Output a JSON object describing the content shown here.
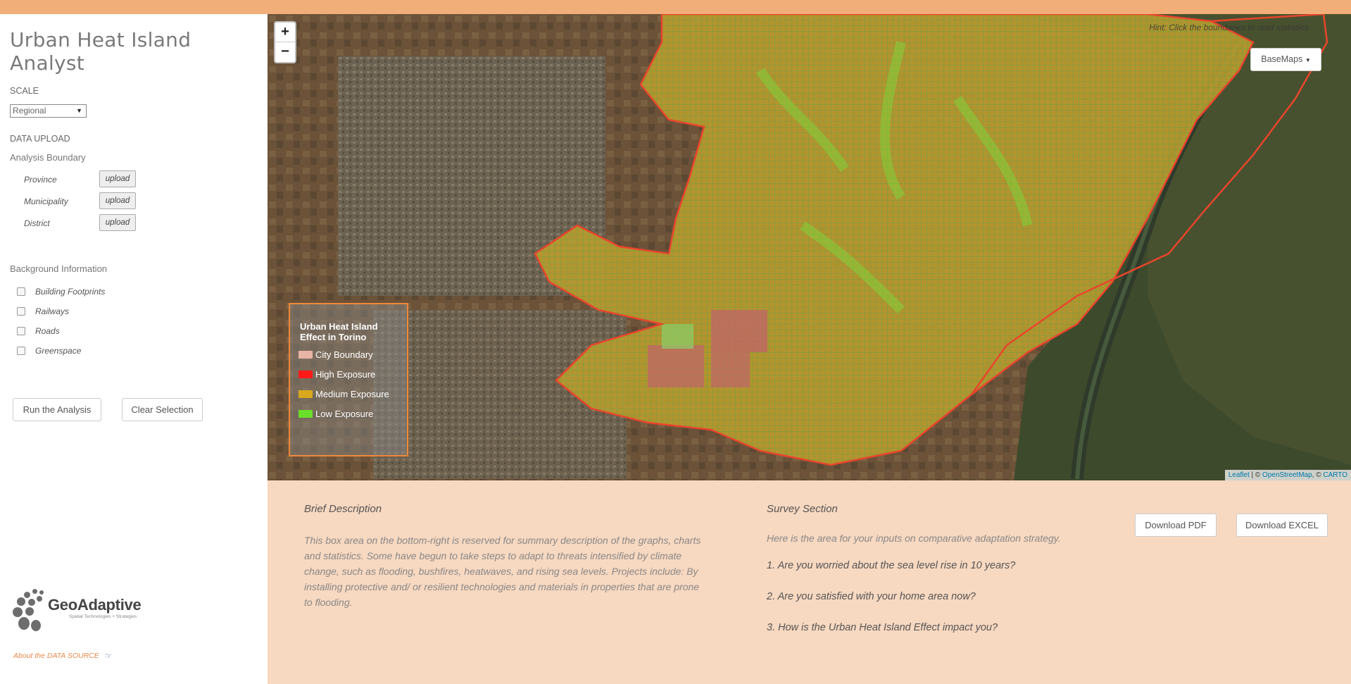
{
  "app": {
    "title": "Urban Heat Island Analyst"
  },
  "sidebar": {
    "scale_label": "SCALE",
    "scale_value": "Regional",
    "data_upload_label": "DATA UPLOAD",
    "analysis_boundary_label": "Analysis Boundary",
    "boundary_rows": [
      {
        "label": "Province",
        "button": "upload"
      },
      {
        "label": "Municipality",
        "button": "upload"
      },
      {
        "label": "District",
        "button": "upload"
      }
    ],
    "background_label": "Background Information",
    "layers": [
      {
        "label": "Building Footprints",
        "checked": false
      },
      {
        "label": "Railways",
        "checked": false
      },
      {
        "label": "Roads",
        "checked": false
      },
      {
        "label": "Greenspace",
        "checked": false
      }
    ],
    "run_button": "Run the Analysis",
    "clear_button": "Clear Selection",
    "logo_name": "GeoAdaptive",
    "logo_tagline": "Spatial Technologies + Strategies",
    "about_link": "About the DATA SOURCE"
  },
  "map": {
    "zoom_in": "+",
    "zoom_out": "−",
    "hint": "Hint: Click the boundaries to read statistics",
    "basemaps_label": "BaseMaps",
    "legend": {
      "title": "Urban Heat Island Effect in Torino",
      "items": [
        {
          "label": "City Boundary",
          "color": "#e8b4a6"
        },
        {
          "label": "High Exposure",
          "color": "#ff1a1a"
        },
        {
          "label": "Medium Exposure",
          "color": "#d9a81e"
        },
        {
          "label": "Low Exposure",
          "color": "#6ae02a"
        }
      ]
    },
    "attribution": {
      "leaflet": "Leaflet",
      "sep1": " | © ",
      "osm": "OpenStreetMap",
      "sep2": ", © ",
      "carto": "CARTO"
    }
  },
  "bottom": {
    "description_title": "Brief Description",
    "description_text": "This box area on the bottom-right is reserved for summary description of the graphs, charts and statistics. Some have begun to take steps to adapt to threats intensified by climate change, such as flooding, bushfires, heatwaves, and rising sea levels. Projects include: By installing protective and/ or resilient technologies and materials in properties that are prone to flooding.",
    "survey_title": "Survey Section",
    "survey_intro": "Here is the area for your inputs on comparative adaptation strategy.",
    "questions": [
      "1. Are you worried about the sea level rise in 10 years?",
      "2. Are you satisfied with your home area now?",
      "3. How is the Urban Heat Island Effect impact you?"
    ],
    "download_pdf": "Download PDF",
    "download_excel": "Download EXCEL"
  }
}
